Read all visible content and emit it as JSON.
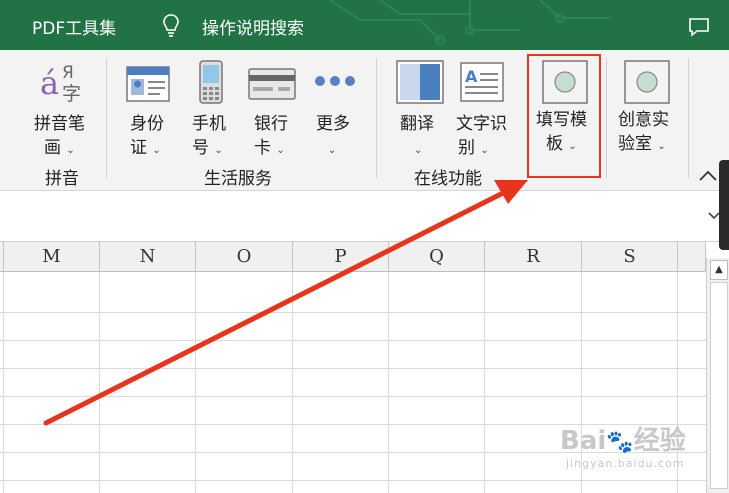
{
  "titlebar": {
    "tabs": [
      "PDF工具集",
      "操作说明搜索"
    ],
    "colors": {
      "background": "#217346",
      "text": "#ffffff"
    },
    "icons": {
      "tellme": "lightbulb-icon",
      "comments": "comment-icon"
    }
  },
  "ribbon": {
    "groups": {
      "pinyin": {
        "label": "拼音",
        "buttons": [
          {
            "line1": "拼音笔",
            "line2": "画",
            "icon": "pinyin-icon"
          }
        ]
      },
      "life": {
        "label": "生活服务",
        "buttons": [
          {
            "line1": "身份",
            "line2": "证",
            "icon": "id-card-icon"
          },
          {
            "line1": "手机",
            "line2": "号",
            "icon": "phone-icon"
          },
          {
            "line1": "银行",
            "line2": "卡",
            "icon": "bank-card-icon"
          },
          {
            "line1": "更多",
            "line2": "",
            "icon": "more-dots-icon"
          }
        ]
      },
      "online": {
        "label": "在线功能",
        "buttons": [
          {
            "line1": "翻译",
            "line2": "",
            "icon": "translate-icon"
          },
          {
            "line1": "文字识",
            "line2": "别",
            "icon": "ocr-icon"
          },
          {
            "line1": "填写模",
            "line2": "板",
            "icon": "template-icon"
          },
          {
            "line1": "创意实",
            "line2": "验室",
            "icon": "creative-lab-icon"
          }
        ]
      }
    },
    "pinyin_glyphs": {
      "accent": "á",
      "cyrillic": "Я",
      "han": "字"
    },
    "ocr_glyph": "A",
    "caret": "⌄"
  },
  "sheet": {
    "columns": [
      "M",
      "N",
      "O",
      "P",
      "Q",
      "R",
      "S"
    ]
  },
  "watermark": {
    "brand": "Bai",
    "brand_suffix": "经验",
    "url": "jingyan.baidu.com"
  },
  "annotation_color": "#e8341c"
}
